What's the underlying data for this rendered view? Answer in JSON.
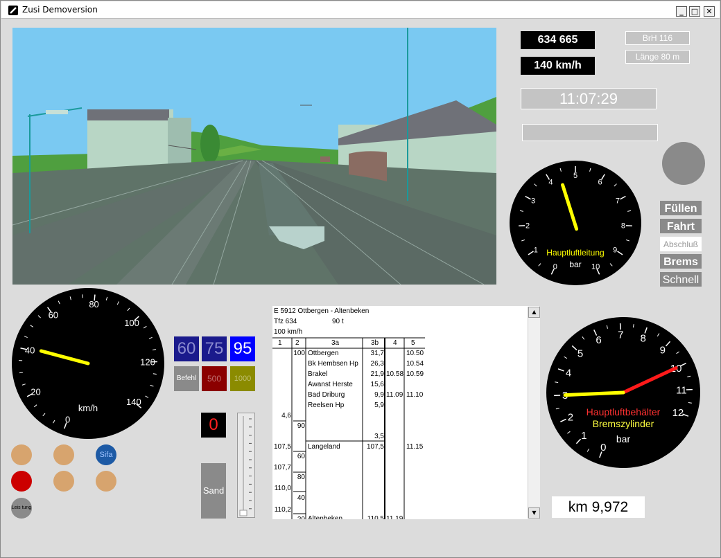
{
  "window": {
    "title": "Zusi Demoversion",
    "minimize": "_",
    "maximize": "□",
    "close": "✕"
  },
  "train": {
    "number": "634 665",
    "speed_display": "140 km/h",
    "brake_ratio": "BrH 116",
    "length": "Länge 80 m",
    "clock": "11:07:29",
    "message": ""
  },
  "brake_valve": {
    "buttons": [
      "Füllen",
      "Fahrt",
      "Abschluß",
      "Brems",
      "Schnell"
    ],
    "active": "Abschluß"
  },
  "main_pipe_gauge": {
    "label": "Hauptluftleitung",
    "unit": "bar",
    "ticks": [
      "0",
      "1",
      "2",
      "3",
      "4",
      "5",
      "6",
      "7",
      "8",
      "9",
      "10"
    ],
    "value": 4.4,
    "max": 10
  },
  "cylinder_gauge": {
    "label1": "Hauptluftbehälter",
    "label2": "Bremszylinder",
    "unit": "bar",
    "ticks": [
      "0",
      "1",
      "2",
      "3",
      "4",
      "5",
      "6",
      "7",
      "8",
      "9",
      "10",
      "11",
      "12"
    ],
    "reservoir_value": 10,
    "cylinder_value": 3,
    "max": 12
  },
  "speedometer": {
    "unit": "km/h",
    "ticks": [
      "0",
      "20",
      "40",
      "60",
      "80",
      "100",
      "120",
      "140"
    ],
    "value": 41,
    "max": 140
  },
  "lzb": {
    "speeds": [
      "60",
      "75",
      "95"
    ],
    "befehl": "Befehl",
    "b500": "500",
    "b1000": "1000"
  },
  "sand": {
    "label": "Sand",
    "counter": "0"
  },
  "lamps": {
    "sifa": "Sifa",
    "leistung": "Leis tung"
  },
  "colors": {
    "sky": "#7ac9f2",
    "grass": "#4f9f3f",
    "gauge_needle": "#ffff00",
    "reservoir": "#ff1a1a",
    "lzb_dark": "#1a1a8c",
    "lzb_blue": "#0000ff"
  },
  "timetable": {
    "header1": "E 5912  Ottbergen - Altenbeken",
    "header2_a": "Tfz 634",
    "header2_b": "90 t",
    "header3": "100 km/h",
    "columns": [
      "1",
      "2",
      "3a",
      "3b",
      "4",
      "5"
    ],
    "stations": [
      {
        "name": "Ottbergen",
        "km": "31,7",
        "arr": "",
        "dep": "10.50"
      },
      {
        "name": "Bk Hembsen Hp",
        "km": "26,3",
        "arr": "",
        "dep": "10.54"
      },
      {
        "name": "Brakel",
        "km": "21,9",
        "arr": "10.58",
        "dep": "10.59"
      },
      {
        "name": "Awanst Herste",
        "km": "15,6",
        "arr": "",
        "dep": ""
      },
      {
        "name": "Bad Driburg",
        "km": "9,9",
        "arr": "11.09",
        "dep": "11.10"
      },
      {
        "name": "Reelsen Hp",
        "km": "5,9",
        "arr": "",
        "dep": ""
      },
      {
        "name": "Langeland",
        "km": "107,5",
        "arr": "",
        "dep": "11.15"
      },
      {
        "name": "Altenbeken",
        "km": "110,5",
        "arr": "11.19",
        "dep": ""
      }
    ],
    "speed_changes": [
      "100",
      "90",
      "60",
      "80",
      "40",
      "20"
    ],
    "positions": [
      "4,6",
      "107,5",
      "107,7",
      "110,0",
      "110,2"
    ],
    "extra_km": "3,5"
  },
  "position": {
    "km": "km 9,972"
  }
}
